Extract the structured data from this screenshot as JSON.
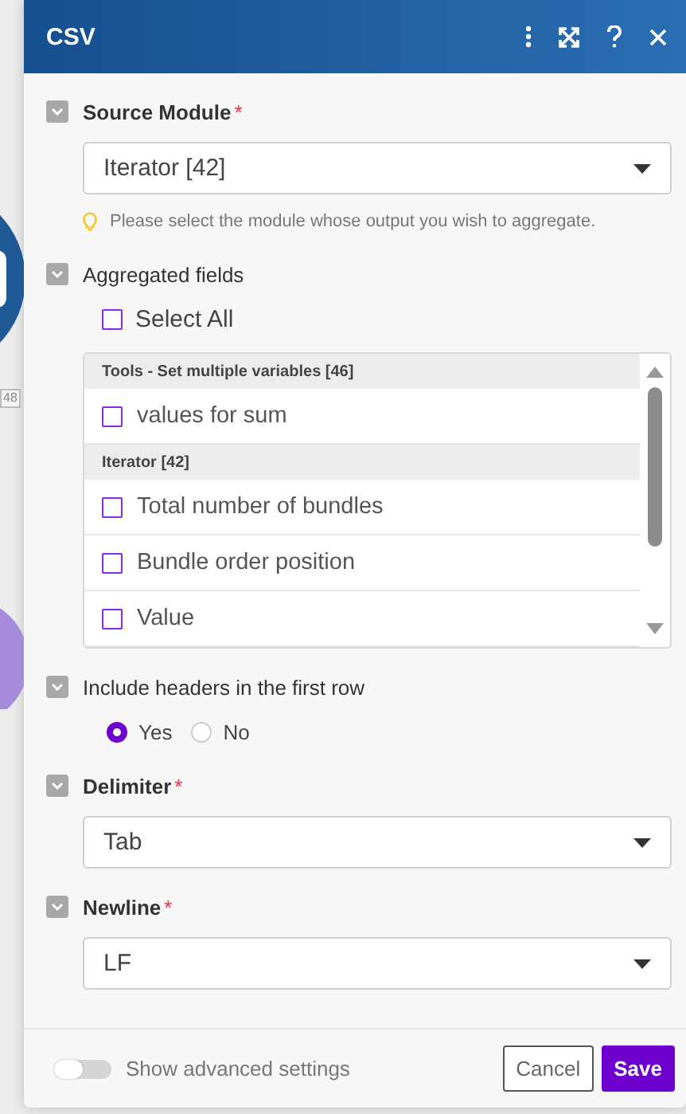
{
  "window": {
    "title": "CSV"
  },
  "canvas": {
    "badge": "48"
  },
  "sections": [
    {
      "kind": "select",
      "label": "Source Module",
      "required_mark": "*",
      "value": "Iterator [42]",
      "hint": "Please select the module whose output you wish to aggregate."
    },
    {
      "kind": "checklist",
      "label": "Aggregated fields",
      "select_all": {
        "label": "Select All",
        "checked": false
      },
      "groups": [
        {
          "title": "Tools - Set multiple variables [46]",
          "items": [
            {
              "label": "values for sum",
              "checked": false
            }
          ]
        },
        {
          "title": "Iterator [42]",
          "items": [
            {
              "label": "Total number of bundles",
              "checked": false
            },
            {
              "label": "Bundle order position",
              "checked": false
            },
            {
              "label": "Value",
              "checked": false
            }
          ]
        }
      ]
    },
    {
      "kind": "radio",
      "label": "Include headers in the first row",
      "options": [
        {
          "label": "Yes",
          "selected": true
        },
        {
          "label": "No",
          "selected": false
        }
      ]
    },
    {
      "kind": "select",
      "label": "Delimiter",
      "required_mark": "*",
      "value": "Tab"
    },
    {
      "kind": "select",
      "label": "Newline",
      "required_mark": "*",
      "value": "LF"
    }
  ],
  "footer": {
    "advanced": {
      "label": "Show advanced settings",
      "on": false
    },
    "buttons": [
      {
        "label": "Cancel",
        "kind": "secondary"
      },
      {
        "label": "Save",
        "kind": "primary"
      }
    ]
  }
}
